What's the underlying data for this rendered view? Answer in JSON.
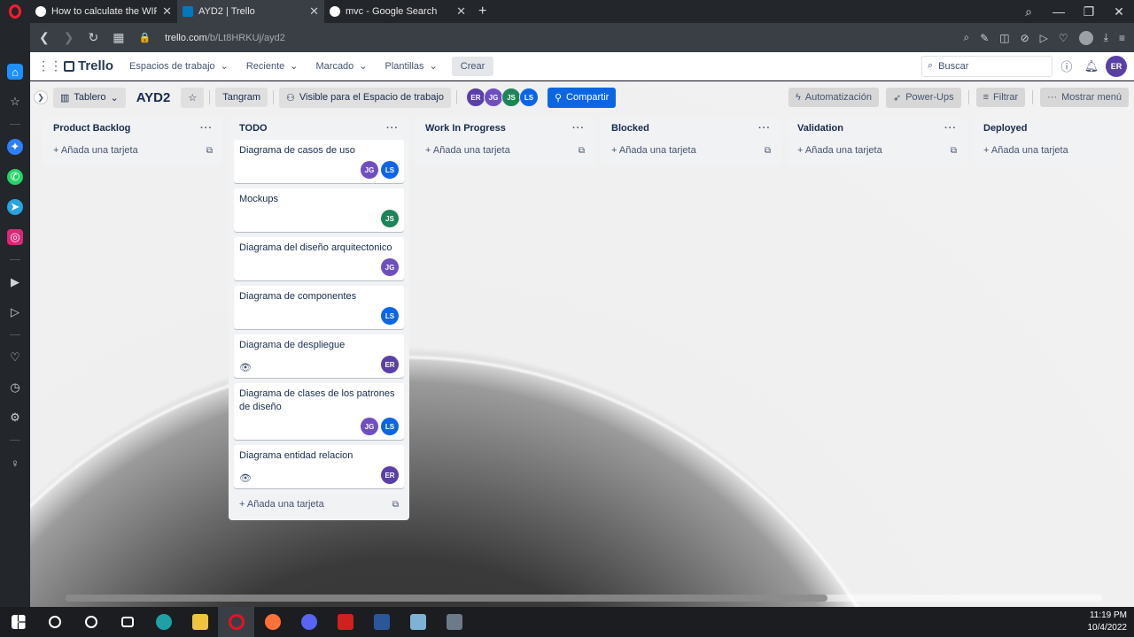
{
  "browser": {
    "tabs": [
      {
        "title": "How to calculate the WIP li",
        "favicon_color": "#ffffff"
      },
      {
        "title": "AYD2 | Trello",
        "favicon_color": "#0079bf"
      },
      {
        "title": "mvc - Google Search",
        "favicon_color": "#ffffff"
      }
    ],
    "new_tab_icon": "plus-icon",
    "url_host": "trello.com",
    "url_path": "/b/Lt8HRKUj/ayd2"
  },
  "trello_header": {
    "logo": "Trello",
    "menus": [
      "Espacios de trabajo",
      "Reciente",
      "Marcado",
      "Plantillas"
    ],
    "create": "Crear",
    "search_placeholder": "Buscar",
    "user_initials": "ER"
  },
  "board_bar": {
    "view": "Tablero",
    "title": "AYD2",
    "workspace": "Tangram",
    "visibility": "Visible para el Espacio de trabajo",
    "members": [
      {
        "initials": "ER",
        "color": "#5a3fa8"
      },
      {
        "initials": "JG",
        "color": "#6f4fbf"
      },
      {
        "initials": "JS",
        "color": "#1f845a"
      },
      {
        "initials": "LS",
        "color": "#0c66e4"
      }
    ],
    "share": "Compartir",
    "automation": "Automatización",
    "powerups": "Power-Ups",
    "filter": "Filtrar",
    "menu": "Mostrar menú"
  },
  "lists": [
    {
      "name": "Product Backlog",
      "cards": [],
      "add_card": "Añada una tarjeta"
    },
    {
      "name": "TODO",
      "cards": [
        {
          "title": "Diagrama de casos de uso",
          "watch": false,
          "members": [
            {
              "initials": "JG",
              "color": "#6f4fbf"
            },
            {
              "initials": "LS",
              "color": "#0c66e4"
            }
          ]
        },
        {
          "title": "Mockups",
          "watch": false,
          "members": [
            {
              "initials": "JS",
              "color": "#1f845a"
            }
          ]
        },
        {
          "title": "Diagrama del diseño arquitectonico",
          "watch": false,
          "members": [
            {
              "initials": "JG",
              "color": "#6f4fbf"
            }
          ]
        },
        {
          "title": "Diagrama de componentes",
          "watch": false,
          "members": [
            {
              "initials": "LS",
              "color": "#0c66e4"
            }
          ]
        },
        {
          "title": "Diagrama de despliegue",
          "watch": true,
          "members": [
            {
              "initials": "ER",
              "color": "#5a3fa8"
            }
          ]
        },
        {
          "title": "Diagrama de clases de los patrones de diseño",
          "watch": false,
          "members": [
            {
              "initials": "JG",
              "color": "#6f4fbf"
            },
            {
              "initials": "LS",
              "color": "#0c66e4"
            }
          ]
        },
        {
          "title": "Diagrama entidad relacion",
          "watch": true,
          "members": [
            {
              "initials": "ER",
              "color": "#5a3fa8"
            }
          ]
        }
      ],
      "add_card": "Añada una tarjeta"
    },
    {
      "name": "Work In Progress",
      "cards": [],
      "add_card": "Añada una tarjeta"
    },
    {
      "name": "Blocked",
      "cards": [],
      "add_card": "Añada una tarjeta"
    },
    {
      "name": "Validation",
      "cards": [],
      "add_card": "Añada una tarjeta"
    },
    {
      "name": "Deployed",
      "cards": [],
      "add_card": "Añada una tarjeta"
    }
  ],
  "taskbar": {
    "time": "11:19 PM",
    "date": "10/4/2022",
    "apps": [
      {
        "name": "windows-start-icon",
        "color": "#ffffff"
      },
      {
        "name": "search-icon",
        "color": "#ffffff"
      },
      {
        "name": "cortana-icon",
        "color": "#ffffff"
      },
      {
        "name": "task-view-icon",
        "color": "#ffffff"
      },
      {
        "name": "edge-icon",
        "color": "#1fa0a7"
      },
      {
        "name": "file-explorer-icon",
        "color": "#f0c33c"
      },
      {
        "name": "opera-icon",
        "color": "#e81123"
      },
      {
        "name": "firefox-icon",
        "color": "#ff7139"
      },
      {
        "name": "discord-icon",
        "color": "#5865f2"
      },
      {
        "name": "acrobat-icon",
        "color": "#d21f1f"
      },
      {
        "name": "word-icon",
        "color": "#2b579a"
      },
      {
        "name": "notes-icon",
        "color": "#7fb3d5"
      },
      {
        "name": "calculator-icon",
        "color": "#6c7a89"
      }
    ]
  }
}
